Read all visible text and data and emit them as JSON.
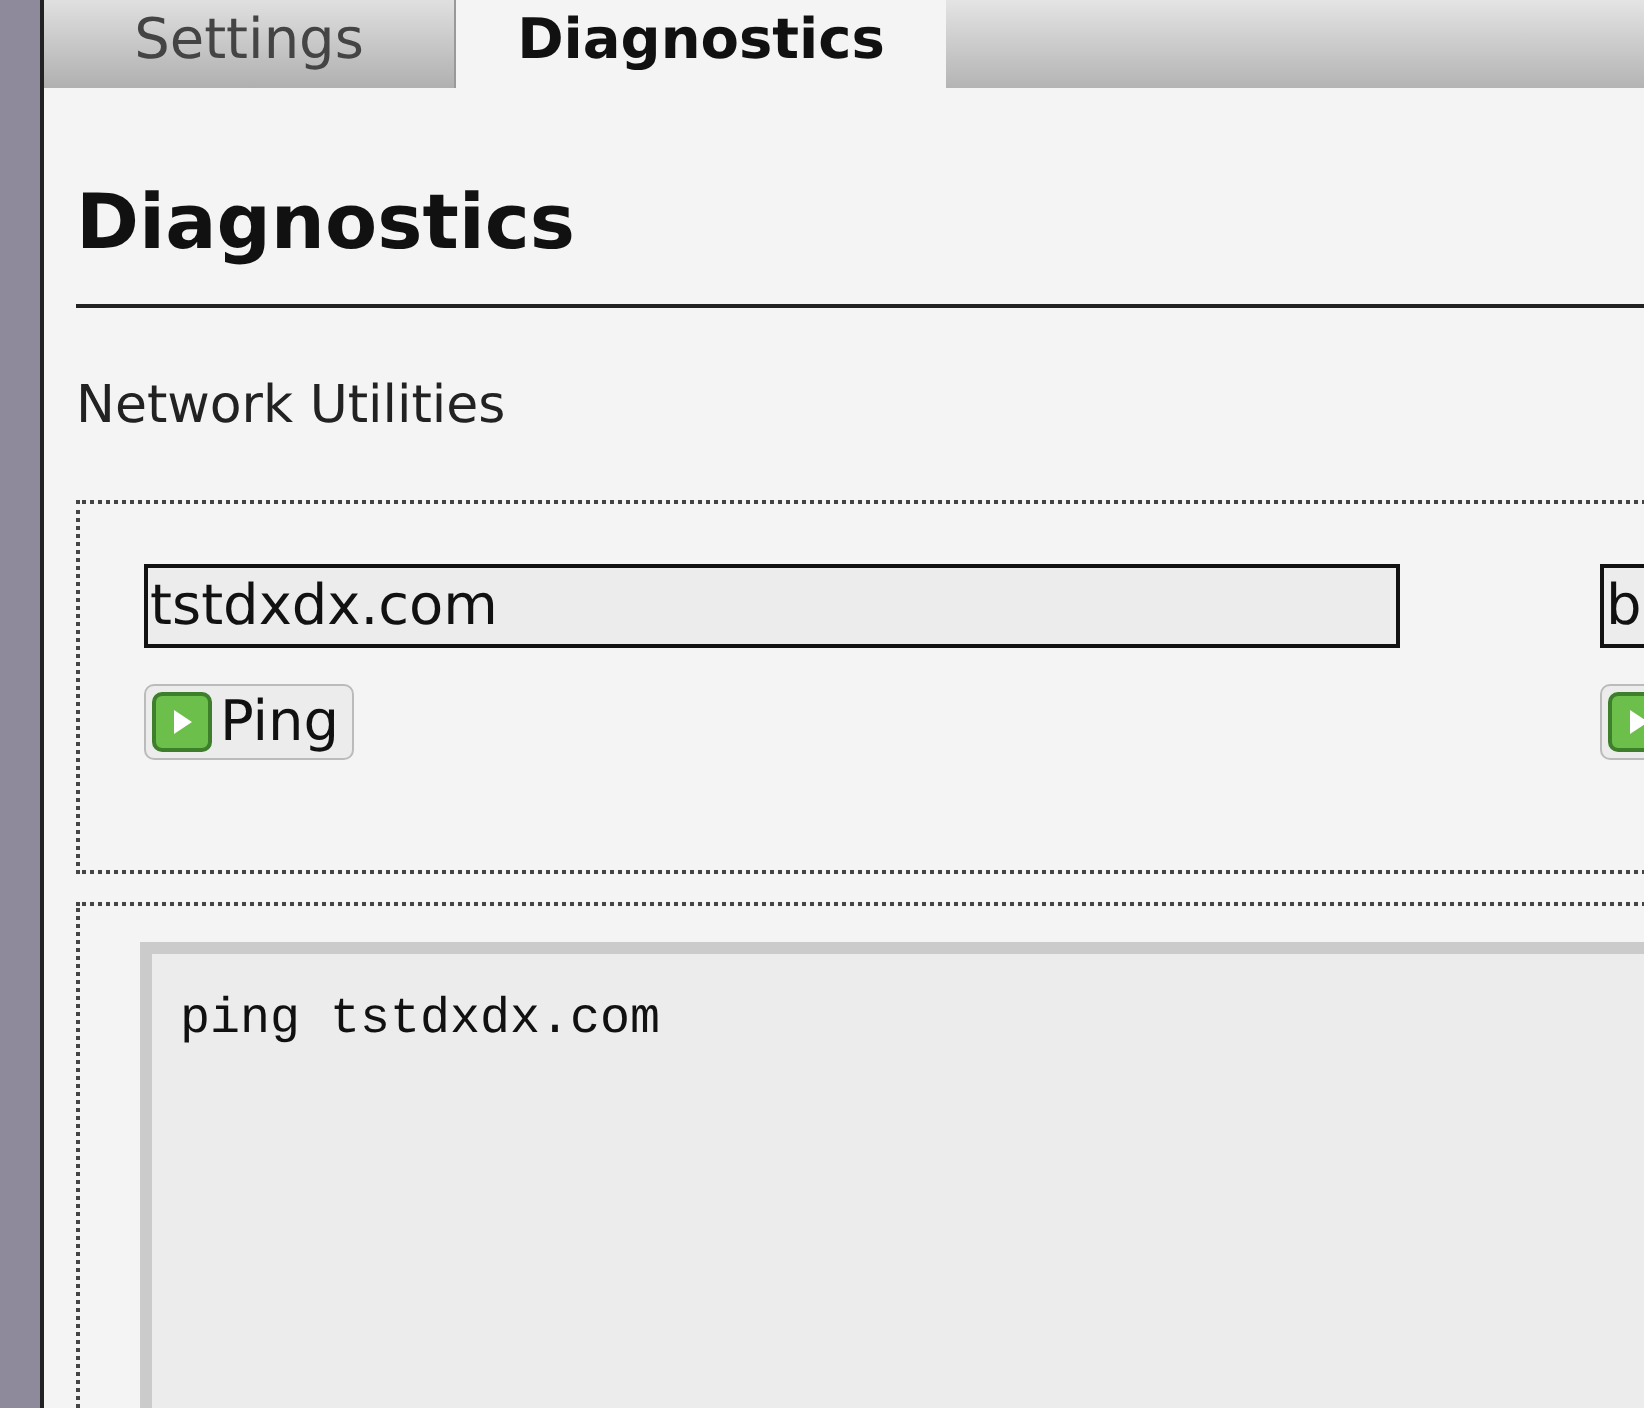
{
  "tabs": [
    {
      "label": "Settings",
      "selected": false
    },
    {
      "label": "Diagnostics",
      "selected": true
    }
  ],
  "heading": "Diagnostics",
  "section_title": "Network Utilities",
  "utilities": [
    {
      "value": "tstdxdx.com",
      "button": "Ping"
    },
    {
      "value": "b"
    }
  ],
  "output": "ping tstdxdx.com"
}
